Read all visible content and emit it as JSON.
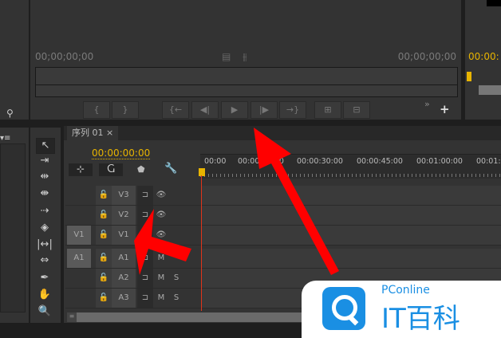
{
  "monitor": {
    "tc_in": "00;00;00;00",
    "tc_out": "00;00;00;00",
    "program_tc": "00:00:",
    "buttons": [
      "mark-in",
      "mark-out",
      "go-to-in",
      "step-back",
      "play",
      "step-forward",
      "go-to-out",
      "insert",
      "overwrite"
    ],
    "more": "»",
    "add": "+"
  },
  "timeline": {
    "tab": "序列 01",
    "close": "×",
    "timecode": "00:00:00:00",
    "ruler": [
      "00:00",
      "00:00:15:00",
      "00:00:30:00",
      "00:00:45:00",
      "00:01:00:00",
      "00:01:"
    ],
    "tracks": [
      {
        "src": "",
        "name": "V3",
        "t2": "👁",
        "t3": ""
      },
      {
        "src": "",
        "name": "V2",
        "t2": "👁",
        "t3": ""
      },
      {
        "src": "V1",
        "name": "V1",
        "t2": "👁",
        "t3": ""
      },
      {
        "src": "A1",
        "name": "A1",
        "t2": "M",
        "t3": ""
      },
      {
        "src": "",
        "name": "A2",
        "t2": "M",
        "t3": "S"
      },
      {
        "src": "",
        "name": "A3",
        "t2": "M",
        "t3": "S"
      }
    ],
    "scroll_grip": "≡"
  },
  "tools": [
    "selection",
    "track-select",
    "ripple-edit",
    "rolling-edit",
    "rate-stretch",
    "razor",
    "slip",
    "slide",
    "pen",
    "hand",
    "zoom"
  ],
  "watermark": {
    "brand": "PConline",
    "text": "IT百科"
  },
  "colors": {
    "accent": "#e8b400",
    "playhead": "#e0341a",
    "arrow": "#ff0000"
  }
}
